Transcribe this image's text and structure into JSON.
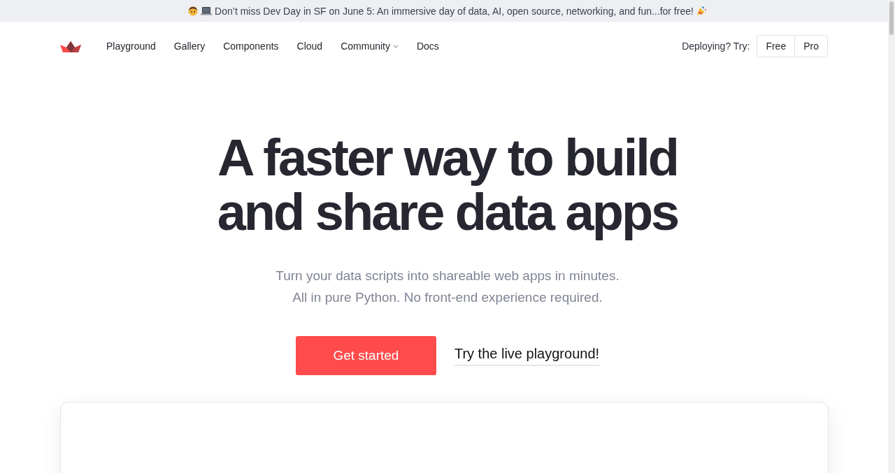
{
  "banner": {
    "text": "Don’t miss Dev Day in SF on June 5: An immersive day of data, AI, open source, networking, and fun...for free!"
  },
  "nav": {
    "items": [
      {
        "label": "Playground",
        "kind": "link"
      },
      {
        "label": "Gallery",
        "kind": "link"
      },
      {
        "label": "Components",
        "kind": "link"
      },
      {
        "label": "Cloud",
        "kind": "link"
      },
      {
        "label": "Community",
        "kind": "dropdown"
      },
      {
        "label": "Docs",
        "kind": "link"
      }
    ],
    "deploy_label": "Deploying? Try:",
    "deploy_buttons": [
      "Free",
      "Pro"
    ]
  },
  "hero": {
    "title_lines": [
      "A faster way to build",
      "and share data apps"
    ],
    "subtitle_lines": [
      "Turn your data scripts into shareable web apps in minutes.",
      "All in pure Python. No front-end experience required."
    ],
    "primary_button": "Get started",
    "secondary_link": "Try the live playground!"
  }
}
